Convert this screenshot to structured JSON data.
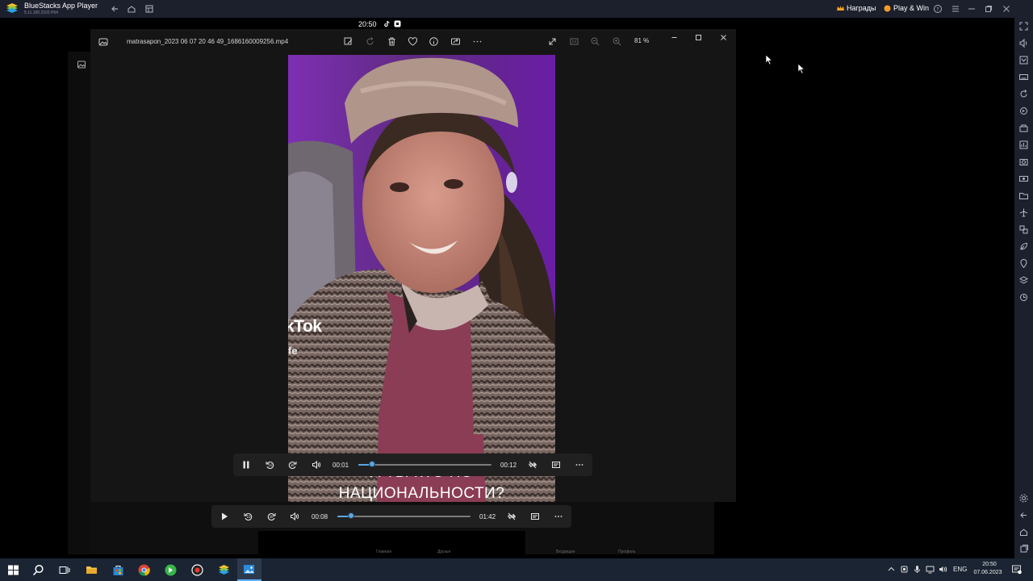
{
  "bluestacks": {
    "app_title": "BlueStacks App Player",
    "version": "5.11.100.2102 P64",
    "rewards_label": "Награды",
    "play_win_label": "Play & Win"
  },
  "android_status": {
    "clock": "20:50"
  },
  "photos": {
    "filename": "matrasapon_2023 06 07 20 46 49_1686160009256.mp4",
    "zoom_level": "81 %"
  },
  "video": {
    "overlay_logo": "kTok",
    "overlay_username": "fe",
    "caption_partial": "А ТЫ КТО ПО",
    "caption_main": "НАЦИОНАЛЬНОСТИ?"
  },
  "player_front": {
    "current_time": "00:01",
    "total_time": "00:12",
    "progress": 0.1,
    "state": "playing"
  },
  "player_back": {
    "current_time": "00:08",
    "total_time": "01:42",
    "progress": 0.1,
    "state": "paused"
  },
  "bottom_nav_partial": {
    "item1": "Главная",
    "item2": "Друзья",
    "item3": "Входящие",
    "item4": "Профиль"
  },
  "taskbar": {
    "language": "ENG",
    "time": "20:50",
    "date": "07.06.2023"
  },
  "colors": {
    "accent": "#5ca6df",
    "titlebar": "#1c1f2c",
    "taskbar": "#1a2433",
    "window_bg": "#151515"
  }
}
